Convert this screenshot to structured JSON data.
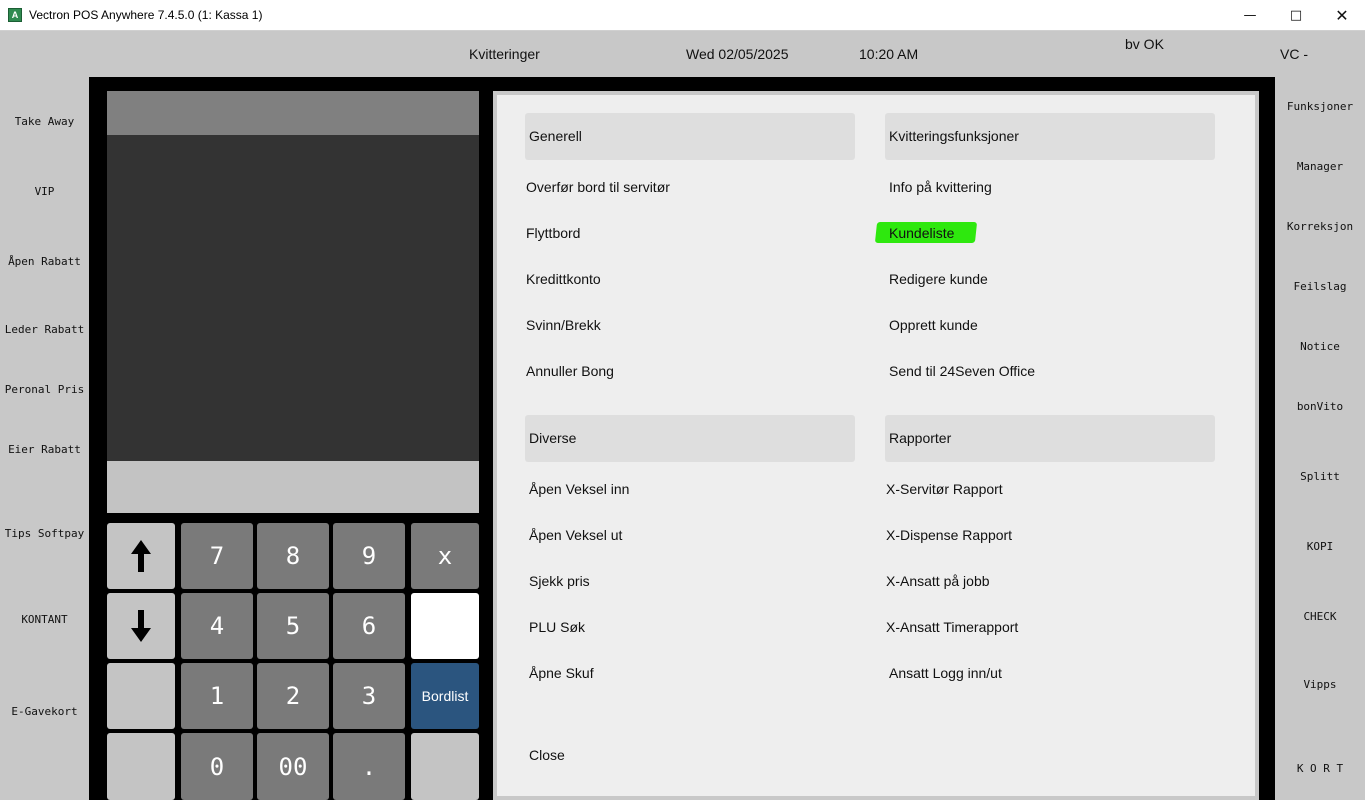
{
  "window": {
    "title": "Vectron POS Anywhere 7.4.5.0 (1: Kassa 1)"
  },
  "status": {
    "section": "Kvitteringer",
    "date": "Wed 02/05/2025",
    "time": "10:20 AM",
    "message": "bv OK",
    "user": "VC -"
  },
  "left_buttons": [
    "Take Away",
    "VIP",
    "Åpen Rabatt",
    "Leder Rabatt",
    "Peronal Pris",
    "Eier Rabatt",
    "Tips Softpay",
    "KONTANT",
    "E-Gavekort"
  ],
  "right_buttons": [
    "Funksjoner",
    "Manager",
    "Korreksjon",
    "Feilslag",
    "Notice",
    "bonVito",
    "Splitt",
    "KOPI",
    "CHECK",
    "Vipps",
    "K O R T"
  ],
  "keypad": {
    "up": "↑",
    "down": "↓",
    "k7": "7",
    "k8": "8",
    "k9": "9",
    "x": "x",
    "k4": "4",
    "k5": "5",
    "k6": "6",
    "k1": "1",
    "k2": "2",
    "k3": "3",
    "bordlist": "Bordlist",
    "k0": "0",
    "k00": "00",
    "dot": "."
  },
  "menu": {
    "generell": {
      "header": "Generell",
      "items": [
        "Overfør bord til servitør",
        "Flyttbord",
        "Kredittkonto",
        "Svinn/Brekk",
        "Annuller Bong"
      ]
    },
    "kvittering": {
      "header": "Kvitteringsfunksjoner",
      "items": [
        "Info på kvittering",
        "Kundeliste",
        "Redigere kunde",
        "Opprett kunde",
        "Send til 24Seven Office"
      ]
    },
    "diverse": {
      "header": "Diverse",
      "items": [
        "Åpen Veksel inn",
        "Åpen Veksel ut",
        "Sjekk pris",
        "PLU Søk",
        "Åpne Skuf"
      ]
    },
    "rapporter": {
      "header": "Rapporter",
      "items": [
        "X-Servitør Rapport",
        "X-Dispense Rapport",
        "X-Ansatt på jobb",
        "X-Ansatt Timerapport",
        "Ansatt Logg inn/ut"
      ]
    },
    "close": "Close"
  },
  "colors": {
    "highlight": "#2ee80e",
    "bordlist": "#2b557f",
    "key": "#7a7a7a"
  },
  "icons": {
    "app": "vectron-app-icon",
    "minimize": "minimize-icon",
    "maximize": "maximize-icon",
    "close": "close-icon"
  }
}
